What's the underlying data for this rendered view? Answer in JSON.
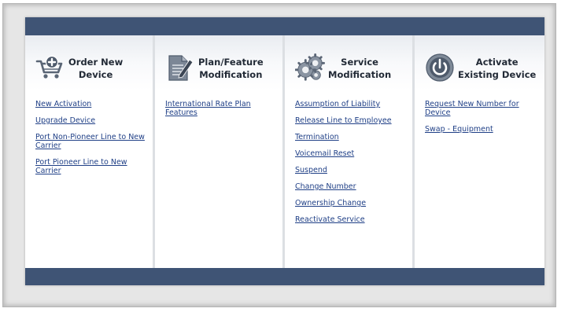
{
  "columns": [
    {
      "title": "Order New\nDevice",
      "icon": "shopping-cart-add-icon",
      "links": [
        "New Activation",
        "Upgrade Device",
        "Port Non-Pioneer Line to New Carrier",
        "Port Pioneer Line to New Carrier"
      ]
    },
    {
      "title": "Plan/Feature\nModification",
      "icon": "document-edit-icon",
      "links": [
        "International Rate Plan Features"
      ]
    },
    {
      "title": "Service\nModification",
      "icon": "gears-icon",
      "links": [
        "Assumption of Liability",
        "Release Line to Employee",
        "Termination",
        "Voicemail Reset",
        "Suspend",
        "Change Number",
        "Ownership Change",
        "Reactivate Service"
      ]
    },
    {
      "title": "Activate\nExisting Device",
      "icon": "power-icon",
      "links": [
        "Request New Number for Device",
        "Swap - Equipment"
      ]
    }
  ],
  "colors": {
    "bar": "#3f5475",
    "link": "#1f3f86",
    "title": "#222a36"
  }
}
